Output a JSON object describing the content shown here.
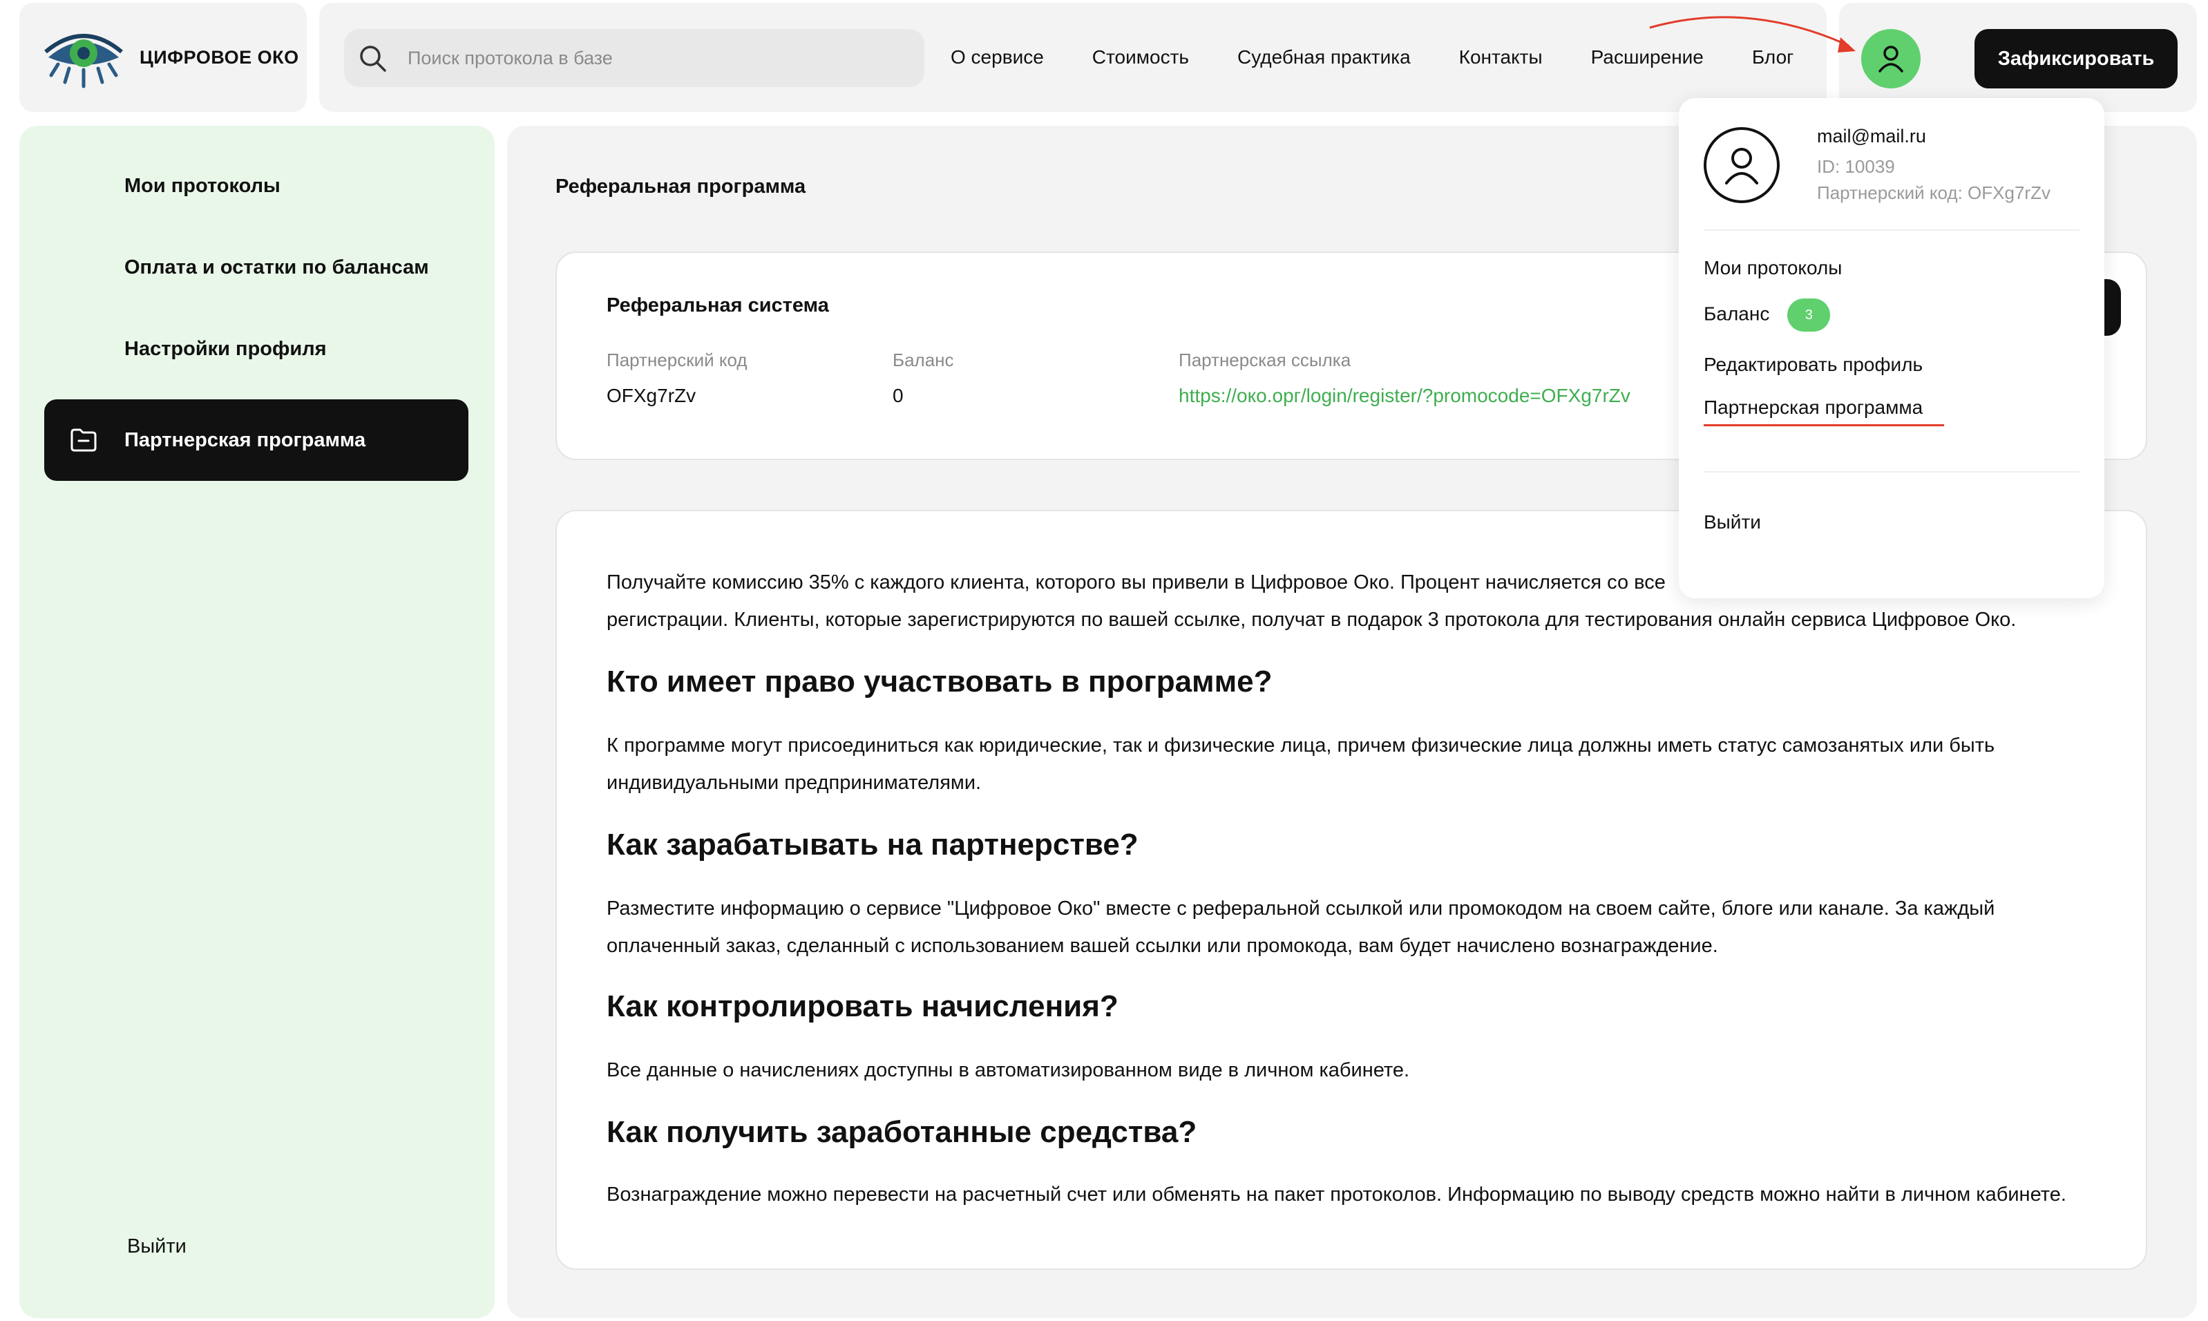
{
  "brand": {
    "name": "ЦИФРОВОЕ ОКО"
  },
  "search": {
    "placeholder": "Поиск протокола в базе"
  },
  "nav": {
    "links": [
      "О сервисе",
      "Стоимость",
      "Судебная практика",
      "Контакты",
      "Расширение",
      "Блог"
    ]
  },
  "header": {
    "record_button": "Зафиксировать"
  },
  "sidebar": {
    "items": [
      {
        "label": "Мои протоколы"
      },
      {
        "label": "Оплата и остатки по балансам"
      },
      {
        "label": "Настройки профиля"
      },
      {
        "label": "Партнерская программа"
      }
    ],
    "logout": "Выйти"
  },
  "main": {
    "title": "Реферальная программа",
    "ref": {
      "title": "Реферальная система",
      "code_label": "Партнерский код",
      "code_value": "OFXg7rZv",
      "balance_label": "Баланс",
      "balance_value": "0",
      "link_label": "Партнерская ссылка",
      "link_value": "https://око.орг/login/register/?promocode=OFXg7rZv"
    },
    "info": {
      "p1_line1": "Получайте комиссию 35% с каждого клиента, которого вы привели в Цифровое Око. Процент начисляется со все",
      "p1_line2": "регистрации. Клиенты, которые зарегистрируются по вашей ссылке, получат в подарок 3 протокола для тестирования онлайн сервиса Цифровое Око.",
      "h1": "Кто имеет право участвовать в программе?",
      "p2_line1": "К программе могут присоединиться как юридические, так и физические лица, причем физические лица должны иметь статус самозанятых или быть",
      "p2_line2": "индивидуальными предпринимателями.",
      "h2": "Как зарабатывать на партнерстве?",
      "p3_line1": "Разместите информацию о сервисе \"Цифровое Око\" вместе с реферальной ссылкой или промокодом на своем сайте, блоге или канале. За каждый",
      "p3_line2": "оплаченный заказ, сделанный с использованием вашей ссылки или промокода, вам будет начислено вознаграждение.",
      "h3": "Как контролировать начисления?",
      "p4": "Все данные о начислениях доступны в автоматизированном виде в личном кабинете.",
      "h4": "Как получить заработанные средства?",
      "p5": "Вознаграждение можно перевести на расчетный счет или обменять на пакет протоколов. Информацию по выводу средств можно найти в личном кабинете."
    }
  },
  "dropdown": {
    "email": "mail@mail.ru",
    "id": "ID: 10039",
    "partner_code": "Партнерский код: OFXg7rZv",
    "items": {
      "protocols": "Мои протоколы",
      "balance": "Баланс",
      "balance_count": "3",
      "edit_profile": "Редактировать профиль",
      "partner": "Партнерская программа",
      "logout": "Выйти"
    }
  },
  "colors": {
    "accent_green": "#5fd06d",
    "link_green": "#3fae4f",
    "sidebar_bg": "#e9f7e8",
    "annotation_red": "#e23c2a"
  }
}
